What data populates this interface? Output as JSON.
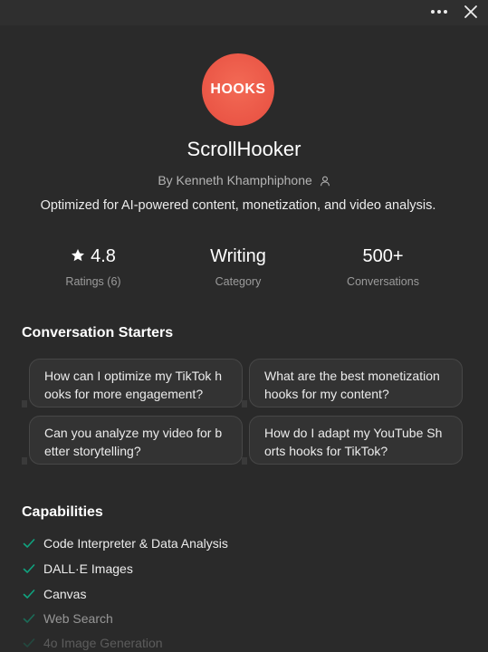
{
  "window": {
    "more_icon": "more-horizontal-icon",
    "close_icon": "close-icon"
  },
  "gpt": {
    "logo_text": "HOOKS",
    "logo_color": "#ea5646",
    "name": "ScrollHooker",
    "author": "By Kenneth Khamphiphone",
    "author_icon": "person-icon",
    "description": "Optimized for AI-powered content, monetization, and video analysis."
  },
  "stats": [
    {
      "value": "4.8",
      "label": "Ratings (6)",
      "icon": "star-icon"
    },
    {
      "value": "Writing",
      "label": "Category"
    },
    {
      "value": "500+",
      "label": "Conversations"
    }
  ],
  "starters": {
    "heading": "Conversation Starters",
    "items": [
      {
        "line1": "How can I optimize my TikTok h",
        "line2": "ooks for more engagement?"
      },
      {
        "line1": "What are the best monetization",
        "line2": "hooks for my content?"
      },
      {
        "line1": "Can you analyze my video for b",
        "line2": "etter storytelling?"
      },
      {
        "line1": "How do I adapt my YouTube Sh",
        "line2": "orts hooks for TikTok?"
      }
    ]
  },
  "capabilities": {
    "heading": "Capabilities",
    "check_color": "#10a37f",
    "items": [
      {
        "label": "Code Interpreter & Data Analysis"
      },
      {
        "label": "DALL·E Images"
      },
      {
        "label": "Canvas"
      },
      {
        "label": "Web Search"
      },
      {
        "label": "4o Image Generation"
      }
    ]
  }
}
